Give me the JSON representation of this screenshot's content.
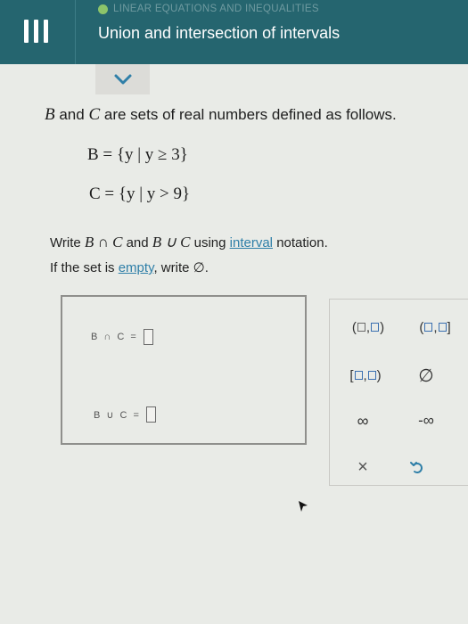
{
  "header": {
    "topic": "LINEAR EQUATIONS AND INEQUALITIES",
    "title": "Union and intersection of intervals",
    "topic_dot_color": "#8cc46a"
  },
  "problem": {
    "intro_var1": "B",
    "intro_and": "and",
    "intro_var2": "C",
    "intro_rest": "are sets of real numbers defined as follows.",
    "set_b": "B = {y | y ≥ 3}",
    "set_c": "C = {y | y > 9}",
    "line1_prefix": "Write",
    "line1_expr1": "B ∩ C",
    "line1_and": "and",
    "line1_expr2": "B ∪ C",
    "line1_using": "using",
    "line1_link": "interval",
    "line1_suffix": "notation.",
    "line2_prefix": "If the set is",
    "line2_link": "empty",
    "line2_suffix": ", write ∅."
  },
  "answers": {
    "intersection_label": "B ∩ C =",
    "union_label": "B ∪ C ="
  },
  "keypad": {
    "open_open_left": "(",
    "open_open_sep": ",",
    "open_open_right": ")",
    "open_closed_left": "(",
    "open_closed_sep": ",",
    "open_closed_right": "]",
    "closed_open_left": "[",
    "closed_open_sep": ",",
    "closed_open_right": ")",
    "empty_set": "∅",
    "infinity": "∞",
    "neg_infinity": "-∞",
    "clear": "×",
    "undo_icon": "undo-icon"
  },
  "colors": {
    "header_bg": "#25656f",
    "link": "#2f7fa8",
    "keypad_square": "#3a6fb0"
  }
}
